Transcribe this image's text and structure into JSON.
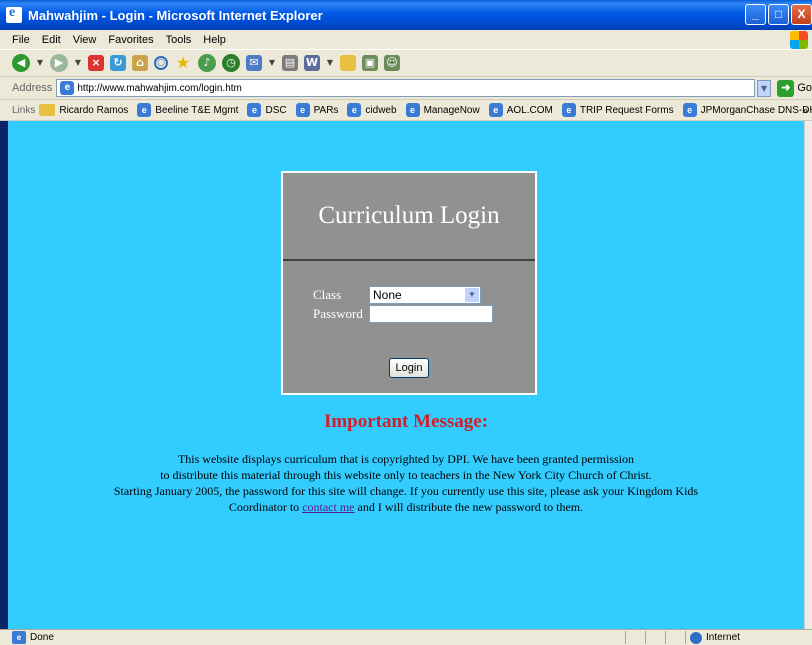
{
  "window": {
    "title": "Mahwahjim - Login - Microsoft Internet Explorer",
    "minimize": "_",
    "maximize": "□",
    "close": "X"
  },
  "menu": [
    "File",
    "Edit",
    "View",
    "Favorites",
    "Tools",
    "Help"
  ],
  "address": {
    "label": "Address",
    "url": "http://www.mahwahjim.com/login.htm",
    "go_label": "Go"
  },
  "links": {
    "label": "Links",
    "items": [
      "Ricardo Ramos",
      "Beeline T&E Mgmt",
      "DSC",
      "PARs",
      "cidweb",
      "ManageNow",
      "AOL.COM",
      "TRIP Request Forms",
      "JPMorganChase DNS-DHCP"
    ]
  },
  "login": {
    "title": "Curriculum Login",
    "class_label": "Class",
    "class_value": "None",
    "password_label": "Password",
    "password_value": "",
    "button": "Login"
  },
  "message": {
    "heading": "Important Message:",
    "line1": "This website displays curriculum that is copyrighted by DPI. We have been granted permission",
    "line2": "to distribute this material through this website only to teachers in the New York City Church of Christ.",
    "line3": "Starting January 2005, the password for this site will change. If you currently use this site, please ask your Kingdom Kids",
    "line4_pre": "Coordinator to ",
    "link": "contact me",
    "line4_post": " and I will distribute the new password to them."
  },
  "status": {
    "text": "Done",
    "zone": "Internet"
  },
  "colors": {
    "page_background": "#33CCFF",
    "login_box": "#919191",
    "heading": "#D0202A"
  }
}
